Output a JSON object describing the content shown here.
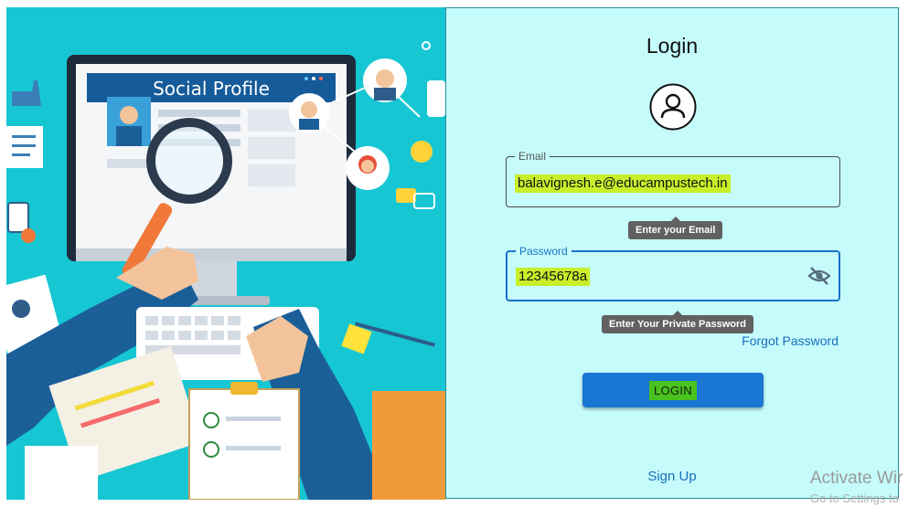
{
  "illustration": {
    "profile_title": "Social Profile",
    "bg_color": "#17c6d3"
  },
  "login": {
    "title": "Login",
    "email_label": "Email",
    "email_value": "balavignesh.e@educampustech.in",
    "email_tooltip": "Enter your Email",
    "password_label": "Password",
    "password_value": "12345678a",
    "password_tooltip": "Enter Your Private Password",
    "forgot_label": "Forgot Password",
    "login_label": "LOGIN",
    "signup_label": "Sign Up",
    "panel_bg": "#c5fbfb",
    "accent": "#1976d2"
  },
  "watermark": {
    "line1": "Activate Wir",
    "line2": "Go to Settings to"
  }
}
